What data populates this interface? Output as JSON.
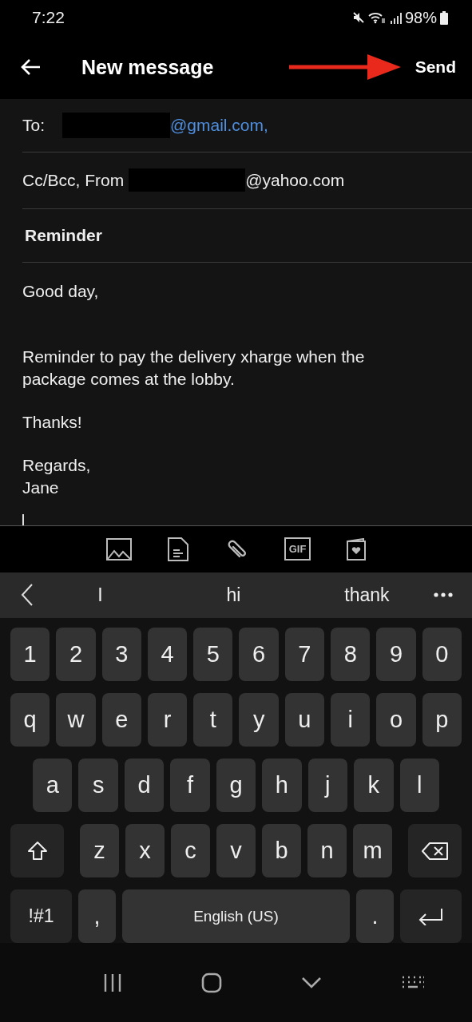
{
  "status_bar": {
    "time": "7:22",
    "battery": "98%"
  },
  "header": {
    "title": "New message",
    "send": "Send"
  },
  "to": {
    "label": "To:",
    "address": "@gmail.com,"
  },
  "from": {
    "label": "Cc/Bcc, From",
    "address": "@yahoo.com"
  },
  "subject": "Reminder",
  "body": [
    {
      "lines": [
        "Good day,"
      ]
    },
    {
      "lines": [
        "Reminder to pay the delivery xharge when the package comes at the lobby."
      ]
    },
    {
      "lines": [
        "Thanks!"
      ]
    },
    {
      "lines": [
        "Regards,",
        "Jane"
      ]
    }
  ],
  "attach_tools": [
    {
      "kind": "image"
    },
    {
      "kind": "file"
    },
    {
      "kind": "clip"
    },
    {
      "kind": "gif",
      "label": "GIF"
    },
    {
      "kind": "card"
    }
  ],
  "suggestions": [
    "I",
    "hi",
    "thank"
  ],
  "keyboard": [
    [
      {
        "kind": "char",
        "label": "1"
      },
      {
        "kind": "char",
        "label": "2"
      },
      {
        "kind": "char",
        "label": "3"
      },
      {
        "kind": "char",
        "label": "4"
      },
      {
        "kind": "char",
        "label": "5"
      },
      {
        "kind": "char",
        "label": "6"
      },
      {
        "kind": "char",
        "label": "7"
      },
      {
        "kind": "char",
        "label": "8"
      },
      {
        "kind": "char",
        "label": "9"
      },
      {
        "kind": "char",
        "label": "0"
      }
    ],
    [
      {
        "kind": "char",
        "label": "q"
      },
      {
        "kind": "char",
        "label": "w"
      },
      {
        "kind": "char",
        "label": "e"
      },
      {
        "kind": "char",
        "label": "r"
      },
      {
        "kind": "char",
        "label": "t"
      },
      {
        "kind": "char",
        "label": "y"
      },
      {
        "kind": "char",
        "label": "u"
      },
      {
        "kind": "char",
        "label": "i"
      },
      {
        "kind": "char",
        "label": "o"
      },
      {
        "kind": "char",
        "label": "p"
      }
    ],
    [
      {
        "kind": "char",
        "label": "a"
      },
      {
        "kind": "char",
        "label": "s"
      },
      {
        "kind": "char",
        "label": "d"
      },
      {
        "kind": "char",
        "label": "f"
      },
      {
        "kind": "char",
        "label": "g"
      },
      {
        "kind": "char",
        "label": "h"
      },
      {
        "kind": "char",
        "label": "j"
      },
      {
        "kind": "char",
        "label": "k"
      },
      {
        "kind": "char",
        "label": "l"
      }
    ],
    [
      {
        "kind": "shift"
      },
      {
        "kind": "char",
        "label": "z"
      },
      {
        "kind": "char",
        "label": "x"
      },
      {
        "kind": "char",
        "label": "c"
      },
      {
        "kind": "char",
        "label": "v"
      },
      {
        "kind": "char",
        "label": "b"
      },
      {
        "kind": "char",
        "label": "n"
      },
      {
        "kind": "char",
        "label": "m"
      },
      {
        "kind": "backspace"
      }
    ],
    [
      {
        "kind": "symbols",
        "label": "!#1"
      },
      {
        "kind": "punct",
        "label": ","
      },
      {
        "kind": "space",
        "label": "English (US)"
      },
      {
        "kind": "punct",
        "label": "."
      },
      {
        "kind": "enter"
      }
    ]
  ]
}
